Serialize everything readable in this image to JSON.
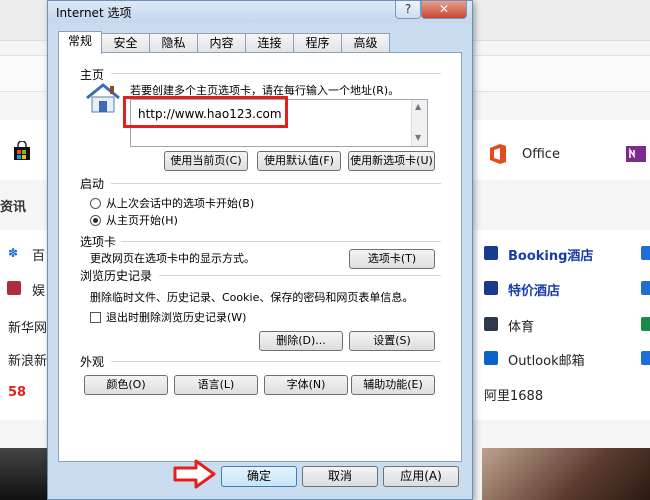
{
  "background": {
    "office_label": "Office",
    "news_label": "资讯",
    "left_items": [
      "百",
      "娱",
      "新华网",
      "新浪新",
      "58"
    ],
    "center_items": [
      "Booking酒店",
      "特价酒店",
      "体育",
      "Outlook邮箱",
      "阿里1688"
    ]
  },
  "dialog": {
    "title": "Internet 选项",
    "help_glyph": "?",
    "close_glyph": "✕",
    "tabs": [
      "常规",
      "安全",
      "隐私",
      "内容",
      "连接",
      "程序",
      "高级"
    ],
    "home": {
      "label": "主页",
      "desc": "若要创建多个主页选项卡，请在每行输入一个地址(R)。",
      "url": "http://www.hao123.com",
      "btn_current": "使用当前页(C)",
      "btn_default": "使用默认值(F)",
      "btn_newtab": "使用新选项卡(U)"
    },
    "startup": {
      "label": "启动",
      "option1": "从上次会话中的选项卡开始(B)",
      "option2": "从主页开始(H)"
    },
    "tabs_section": {
      "label": "选项卡",
      "desc": "更改网页在选项卡中的显示方式。",
      "button": "选项卡(T)"
    },
    "history": {
      "label": "浏览历史记录",
      "desc": "删除临时文件、历史记录、Cookie、保存的密码和网页表单信息。",
      "checkbox": "退出时删除浏览历史记录(W)",
      "btn_delete": "删除(D)...",
      "btn_settings": "设置(S)"
    },
    "appearance": {
      "label": "外观",
      "btn_colors": "颜色(O)",
      "btn_languages": "语言(L)",
      "btn_fonts": "字体(N)",
      "btn_accessibility": "辅助功能(E)"
    },
    "footer": {
      "ok": "确定",
      "cancel": "取消",
      "apply": "应用(A)"
    }
  },
  "colors": {
    "annotation_red": "#e3201b",
    "dialog_frame": "#c9dcf0"
  }
}
